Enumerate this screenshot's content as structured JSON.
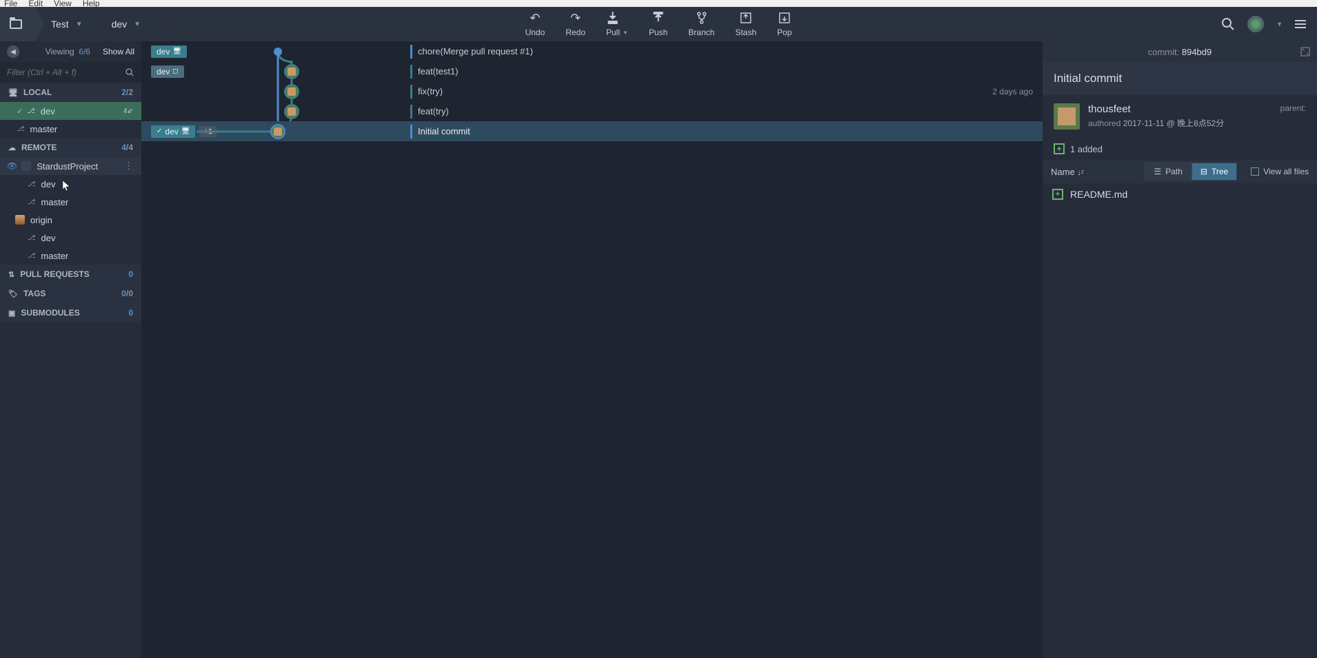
{
  "menubar": {
    "file": "File",
    "edit": "Edit",
    "view": "View",
    "help": "Help"
  },
  "breadcrumb": {
    "repo": "Test",
    "branch": "dev"
  },
  "toolbar": {
    "undo": "Undo",
    "redo": "Redo",
    "pull": "Pull",
    "push": "Push",
    "branch": "Branch",
    "stash": "Stash",
    "pop": "Pop"
  },
  "sidebar": {
    "viewing_label": "Viewing",
    "viewing_count": "6",
    "viewing_total": "/6",
    "show_all": "Show All",
    "filter_placeholder": "Filter (Ctrl + Alt + f)",
    "local": {
      "label": "LOCAL",
      "count": "2",
      "total": "/2",
      "branches": [
        {
          "name": "dev",
          "active": true,
          "badge": "4⇙"
        },
        {
          "name": "master",
          "active": false
        }
      ]
    },
    "remote": {
      "label": "REMOTE",
      "count": "4",
      "total": "/4",
      "remotes": [
        {
          "name": "StardustProject",
          "hover": true,
          "branches": [
            "dev",
            "master"
          ]
        },
        {
          "name": "origin",
          "branches": [
            "dev",
            "master"
          ]
        }
      ]
    },
    "pull_requests": {
      "label": "PULL REQUESTS",
      "count": "0"
    },
    "tags": {
      "label": "TAGS",
      "count": "0",
      "total": "/0"
    },
    "submodules": {
      "label": "SUBMODULES",
      "count": "0"
    }
  },
  "commits": [
    {
      "tags": [
        "dev"
      ],
      "message": "chore(Merge pull request #1)",
      "time": "",
      "sel": false,
      "type": "merge"
    },
    {
      "tags": [
        "dev"
      ],
      "message": "feat(test1)",
      "time": "",
      "sel": false
    },
    {
      "tags": [],
      "message": "fix(try)",
      "time": "2 days ago",
      "sel": false
    },
    {
      "tags": [],
      "message": "feat(try)",
      "time": "",
      "sel": false
    },
    {
      "tags": [
        "dev"
      ],
      "plus": "+1",
      "checked": true,
      "message": "Initial commit",
      "time": "",
      "sel": true
    }
  ],
  "detail": {
    "commit_label": "commit:",
    "commit_hash": "894bd9",
    "title": "Initial commit",
    "author": "thousfeet",
    "authored": "authored",
    "date": "2017-11-11 @ 晚上8点52分",
    "parent": "parent:",
    "added_count": "1 added",
    "filebar": {
      "name": "Name",
      "path": "Path",
      "tree": "Tree",
      "viewall": "View all files"
    },
    "files": [
      {
        "name": "README.md"
      }
    ]
  }
}
